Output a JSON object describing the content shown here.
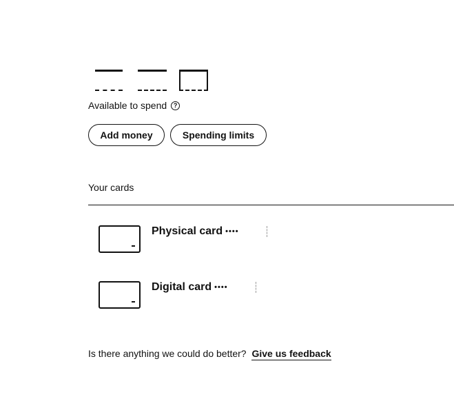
{
  "balance": {
    "amount_redacted": true
  },
  "available_label": "Available to spend",
  "help_icon": "question-circle-icon",
  "actions": {
    "add_money": "Add money",
    "spending_limits": "Spending limits"
  },
  "cards_section": {
    "title": "Your cards",
    "cards": [
      {
        "label": "Physical card",
        "mask": "••••",
        "icon": "card-icon"
      },
      {
        "label": "Digital card",
        "mask": "••••",
        "icon": "card-icon"
      }
    ]
  },
  "feedback": {
    "prompt": "Is there anything we could do better?",
    "link": "Give us feedback"
  }
}
